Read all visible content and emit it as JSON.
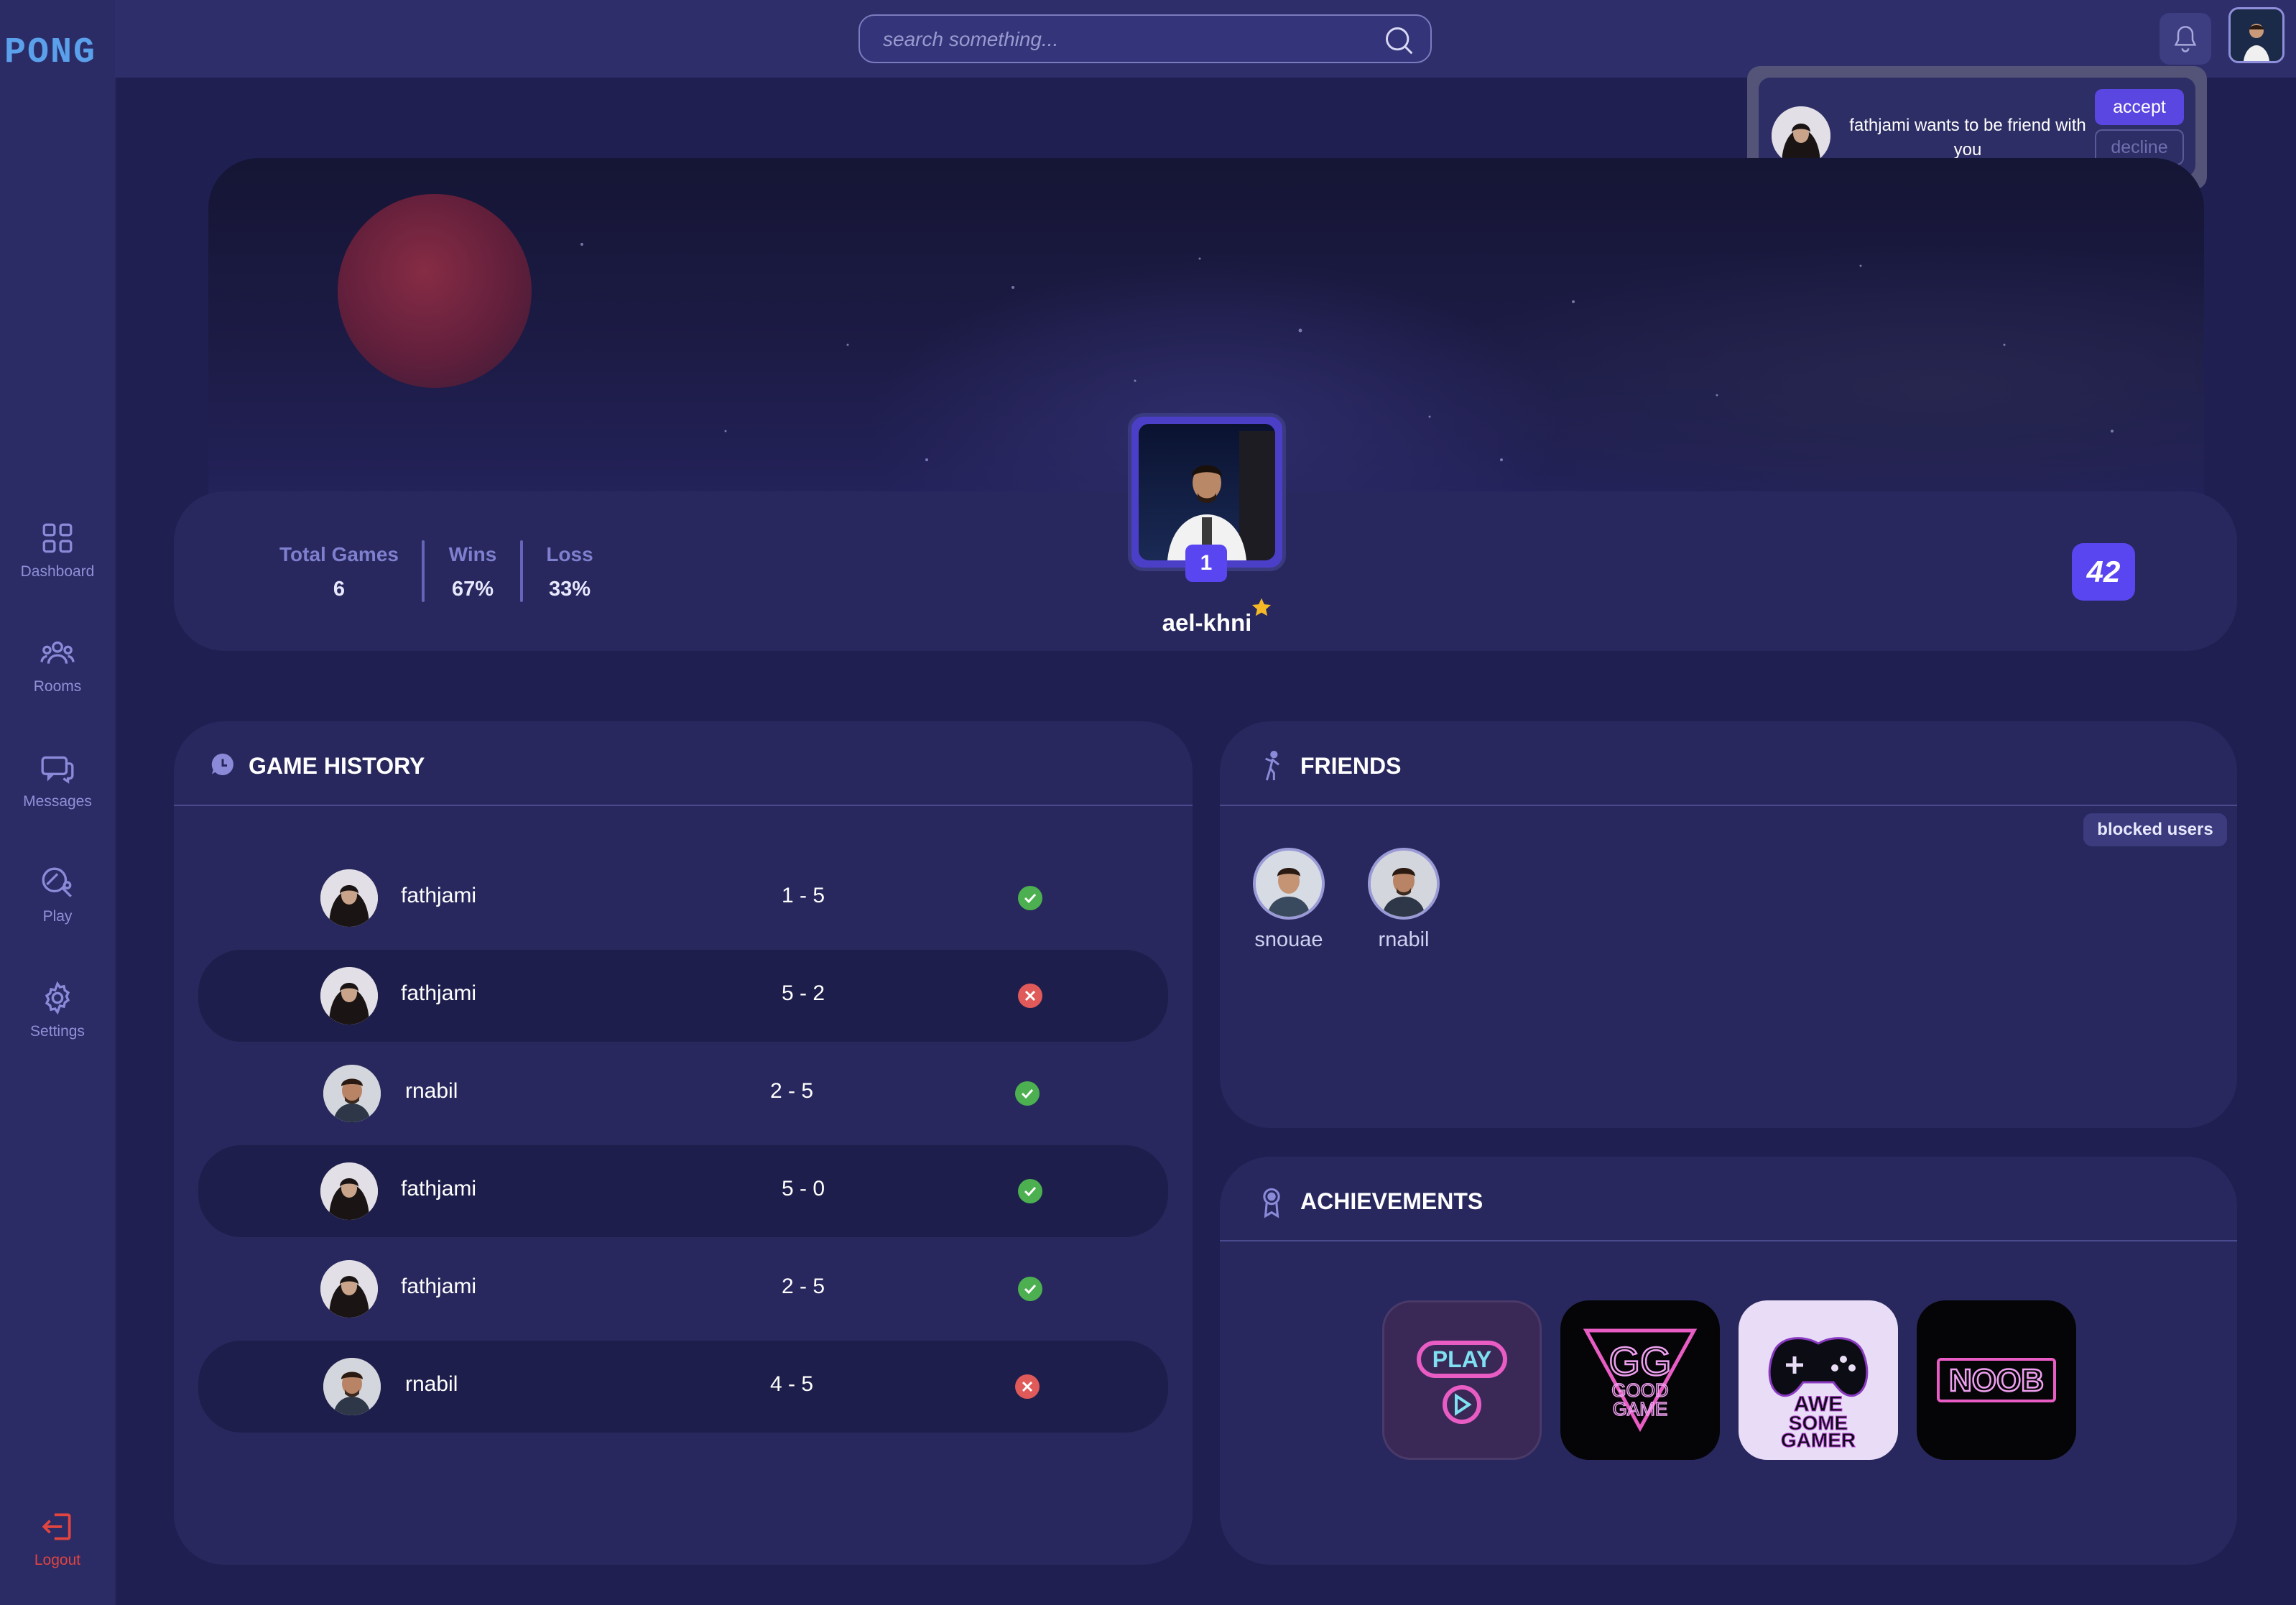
{
  "app": {
    "logo_text": "PONG"
  },
  "sidebar": {
    "items": [
      {
        "label": "Dashboard",
        "icon": "grid-icon"
      },
      {
        "label": "Rooms",
        "icon": "users-icon"
      },
      {
        "label": "Messages",
        "icon": "chat-icon"
      },
      {
        "label": "Play",
        "icon": "controller-icon"
      },
      {
        "label": "Settings",
        "icon": "gear-icon"
      }
    ],
    "logout_label": "Logout"
  },
  "header": {
    "search_placeholder": "search something...",
    "notification_icon": "bell-icon"
  },
  "notification": {
    "message": "fathjami wants to be friend with you",
    "accept_label": "accept",
    "decline_label": "decline"
  },
  "profile": {
    "username": "ael-khni",
    "level": "1",
    "stats": {
      "total_games_label": "Total Games",
      "total_games": "6",
      "wins_label": "Wins",
      "wins": "67%",
      "loss_label": "Loss",
      "loss": "33%"
    },
    "school_badge": "42"
  },
  "game_history": {
    "title": "GAME HISTORY",
    "rows": [
      {
        "opponent": "fathjami",
        "score": "1 - 5",
        "result": "win"
      },
      {
        "opponent": "fathjami",
        "score": "5 - 2",
        "result": "loss"
      },
      {
        "opponent": "rnabil",
        "score": "2 - 5",
        "result": "win"
      },
      {
        "opponent": "fathjami",
        "score": "5 - 0",
        "result": "win"
      },
      {
        "opponent": "fathjami",
        "score": "2 - 5",
        "result": "win"
      },
      {
        "opponent": "rnabil",
        "score": "4 - 5",
        "result": "loss"
      }
    ]
  },
  "friends": {
    "title": "FRIENDS",
    "blocked_label": "blocked users",
    "list": [
      {
        "name": "snouae"
      },
      {
        "name": "rnabil"
      }
    ]
  },
  "achievements": {
    "title": "ACHIEVEMENTS",
    "items": [
      {
        "label": "PLAY"
      },
      {
        "label": "GG GOOD GAME"
      },
      {
        "label": "AWESOME GAMER"
      },
      {
        "label": "NOOB"
      }
    ]
  },
  "colors": {
    "background": "#1f1f52",
    "sidebar": "#2b2b66",
    "panel": "#28285e",
    "accent": "#5a46f0",
    "win": "#4caf50",
    "loss": "#e05a5a",
    "logout": "#e0453f"
  }
}
